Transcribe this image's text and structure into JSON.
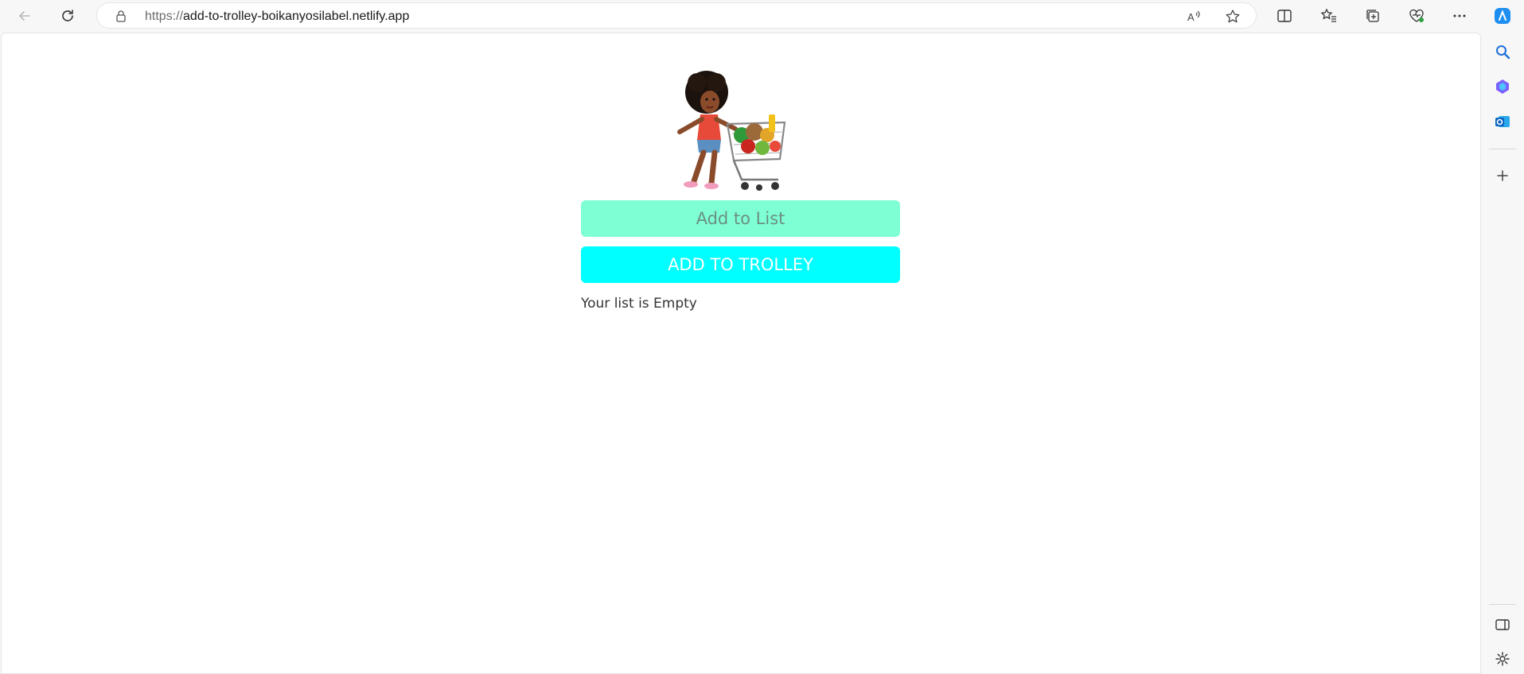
{
  "browser": {
    "url_scheme": "https://",
    "url_host": "add-to-trolley-boikanyosilabel.netlify.app"
  },
  "app": {
    "add_list_label": "Add to  List",
    "add_trolley_label": "ADD TO TROLLEY",
    "empty_message": "Your list is Empty"
  },
  "colors": {
    "add_list_bg": "#7fffd4",
    "add_trolley_bg": "#00ffff"
  }
}
